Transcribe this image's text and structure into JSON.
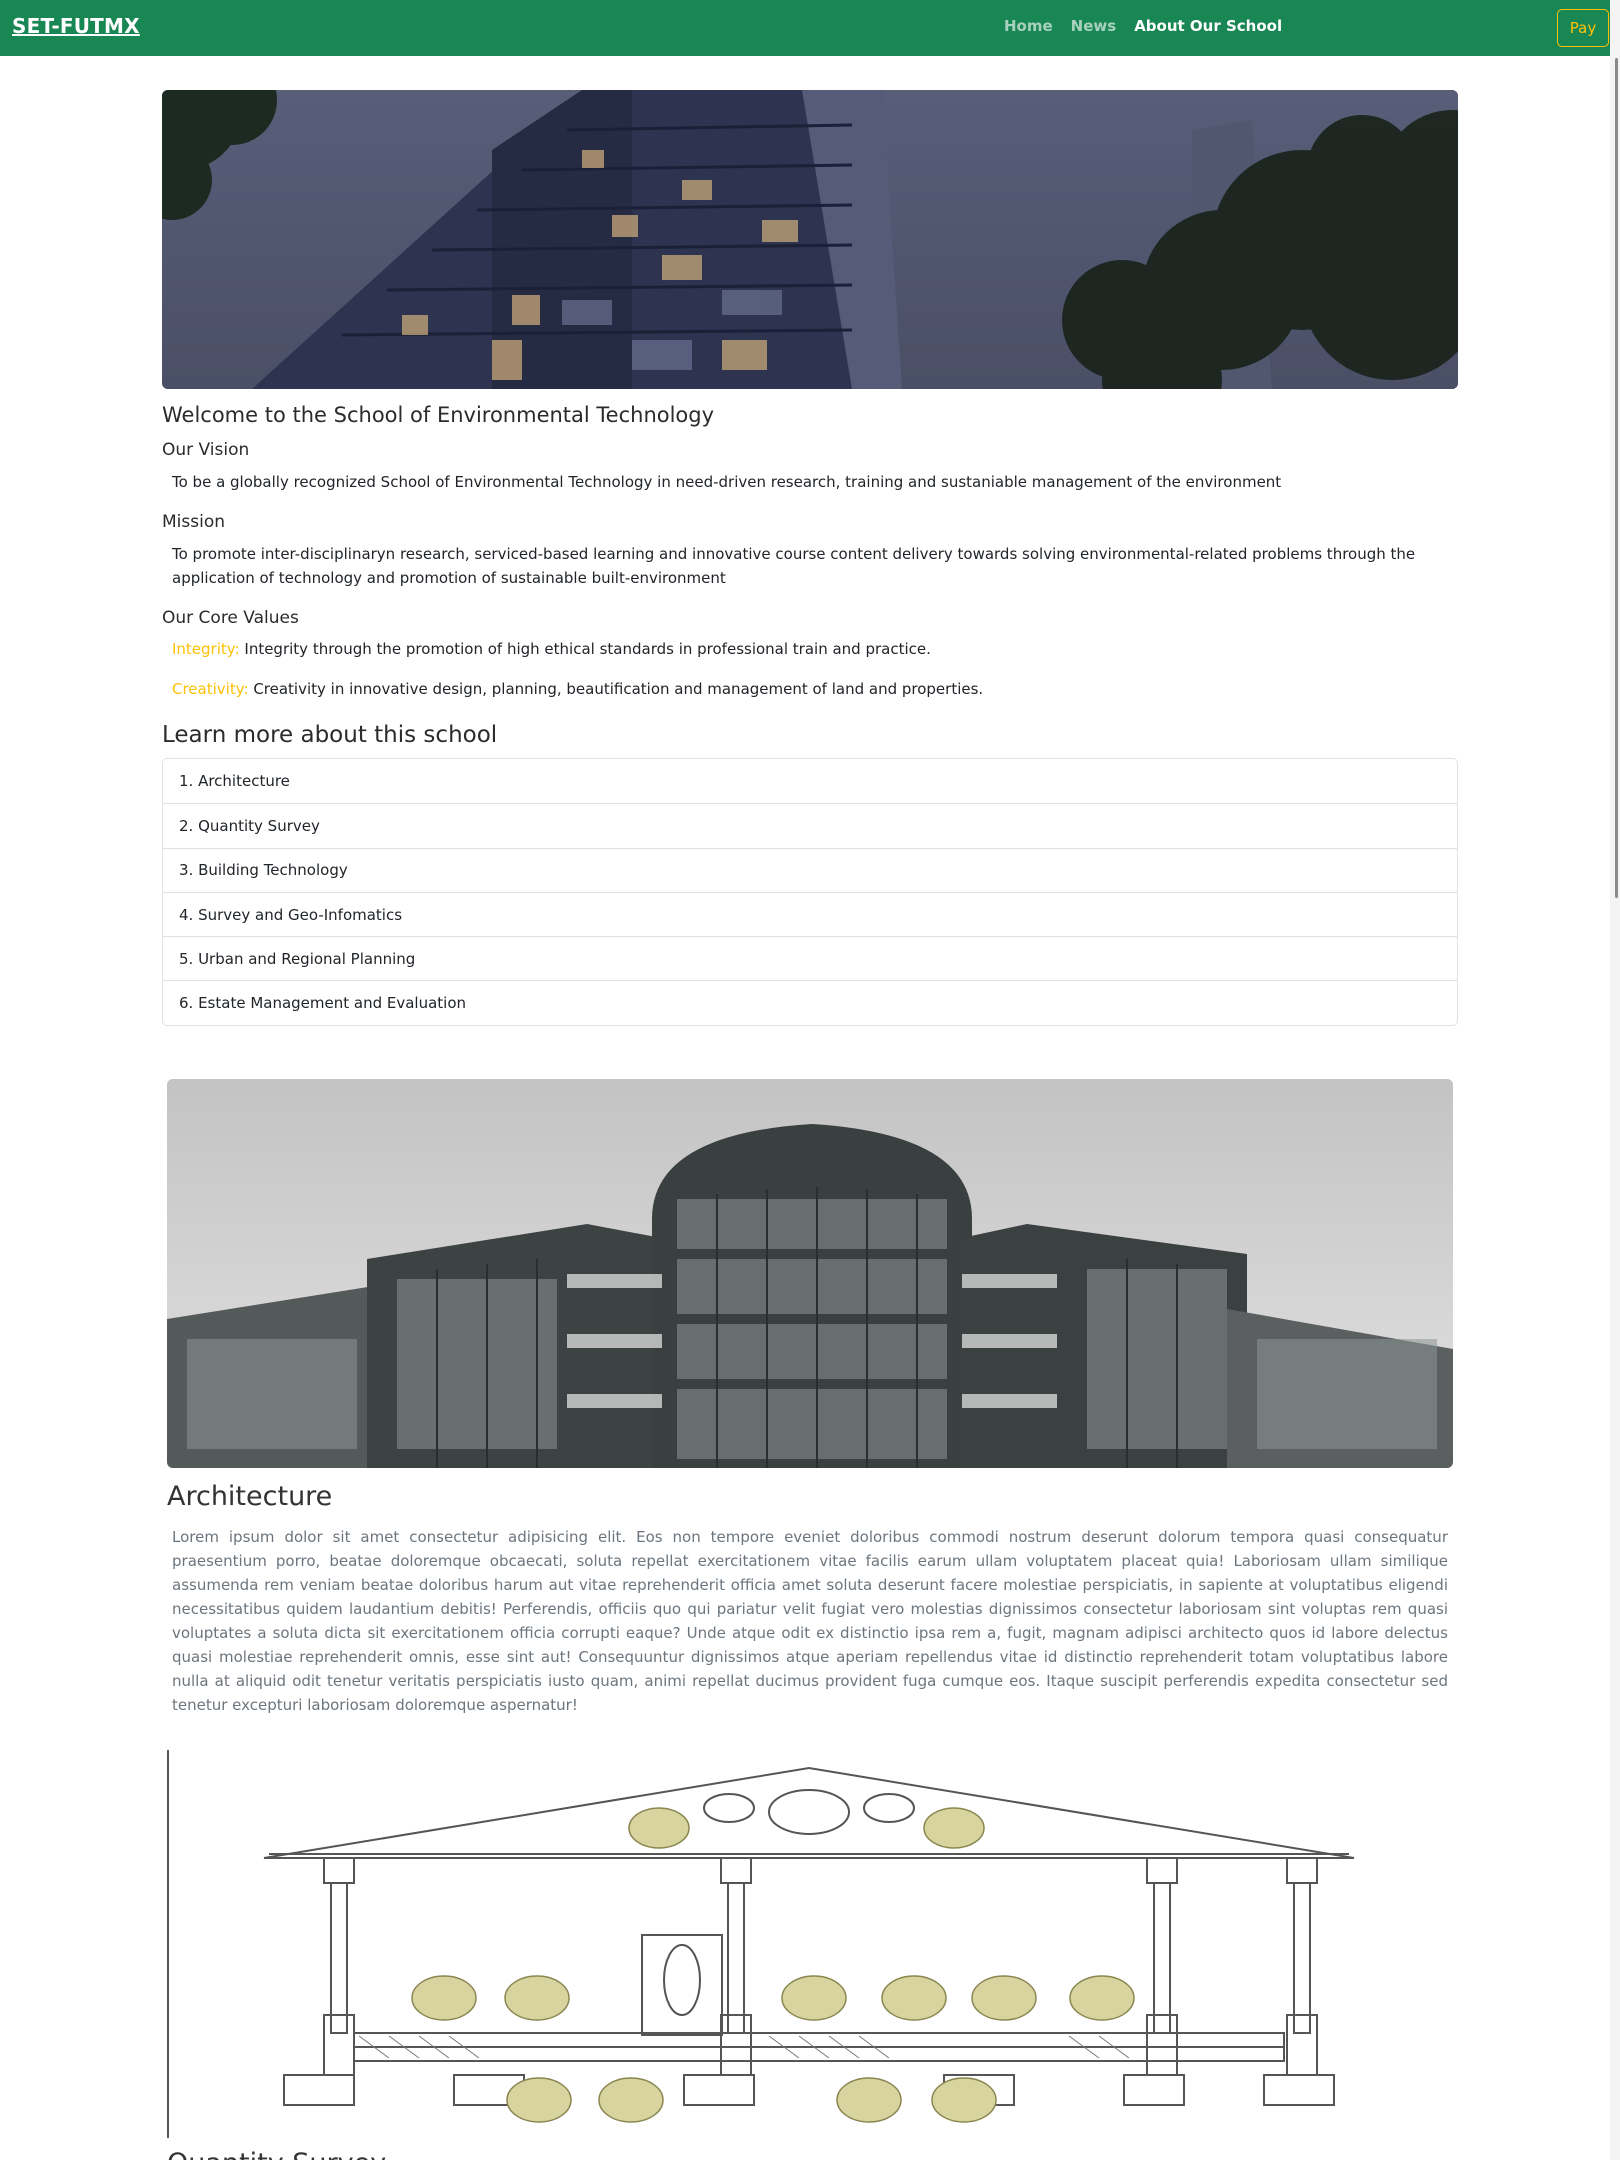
{
  "nav": {
    "brand": "SET-FUTMX",
    "links": [
      {
        "label": "Home"
      },
      {
        "label": "News"
      },
      {
        "label": "About Our School",
        "active": true
      }
    ],
    "pay_label": "Pay",
    "accent_color": "#198754",
    "pay_color": "#ffc107"
  },
  "about": {
    "welcome": "Welcome to the School of Environmental Technology",
    "vision_heading": "Our Vision",
    "vision_text": "To be a globally recognized School of Environmental Technology in need-driven research, training and sustaniable management of the environment",
    "mission_heading": "Mission",
    "mission_text": "To promote inter-disciplinaryn research, serviced-based learning and innovative course content delivery towards solving environmental-related problems through the application of technology and promotion of sustainable built-environment",
    "core_values_heading": "Our Core Values",
    "core_values": [
      {
        "label": "Integrity:",
        "text": " Integrity through the promotion of high ethical standards in professional train and practice."
      },
      {
        "label": "Creativity:",
        "text": " Creativity in innovative design, planning, beautification and management of land and properties."
      }
    ]
  },
  "learn": {
    "heading": "Learn more about this school",
    "items": [
      "1. Architecture",
      "2. Quantity Survey",
      "3. Building Technology",
      "4. Survey and Geo-Infomatics",
      "5. Urban and Regional Planning",
      "6. Estate Management and Evaluation"
    ]
  },
  "architecture": {
    "heading": "Architecture",
    "text": "Lorem ipsum dolor sit amet consectetur adipisicing elit. Eos non tempore eveniet doloribus commodi nostrum deserunt dolorum tempora quasi consequatur praesentium porro, beatae doloremque obcaecati, soluta repellat exercitationem vitae facilis earum ullam voluptatem placeat quia! Laboriosam ullam similique assumenda rem veniam beatae doloribus harum aut vitae reprehenderit officia amet soluta deserunt facere molestiae perspiciatis, in sapiente at voluptatibus eligendi necessitatibus quidem laudantium debitis! Perferendis, officiis quo qui pariatur velit fugiat vero molestias dignissimos consectetur laboriosam sint voluptas rem quasi voluptates a soluta dicta sit exercitationem officia corrupti eaque? Unde atque odit ex distinctio ipsa rem a, fugit, magnam adipisci architecto quos id labore delectus quasi molestiae reprehenderit omnis, esse sint aut! Consequuntur dignissimos atque aperiam repellendus vitae id distinctio reprehenderit totam voluptatibus labore nulla at aliquid odit tenetur veritatis perspiciatis iusto quam, animi repellat ducimus provident fuga cumque eos. Itaque suscipit perferendis expedita consectetur sed tenetur excepturi laboriosam doloremque aspernatur!"
  },
  "quantity_survey": {
    "heading": "Quantity Survey"
  }
}
